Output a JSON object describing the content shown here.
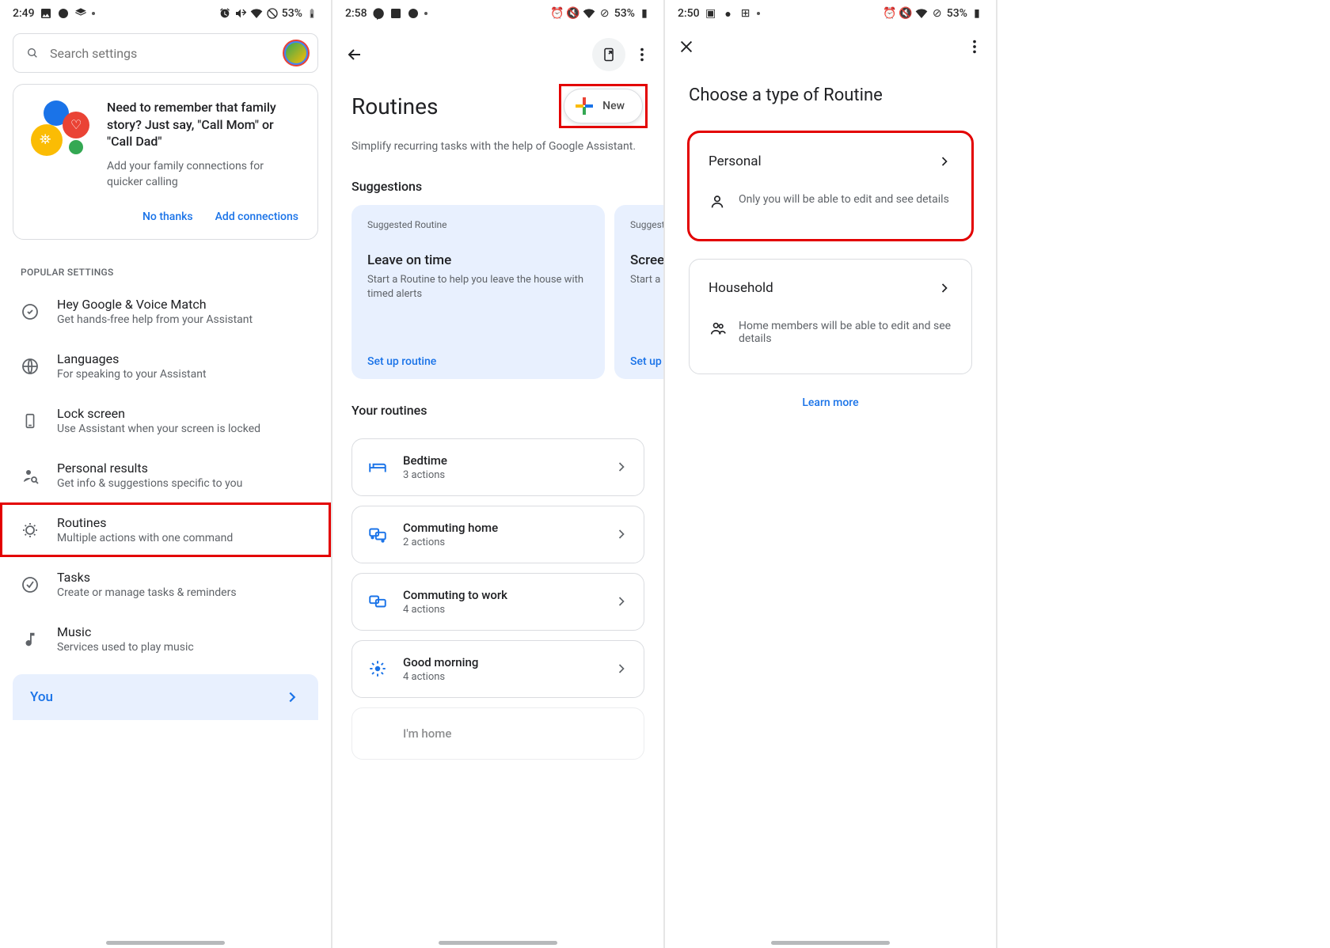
{
  "screen1": {
    "time": "2:49",
    "battery": "53%",
    "search_placeholder": "Search settings",
    "card": {
      "title": "Need to remember that family story? Just say, \"Call Mom\" or \"Call Dad\"",
      "subtitle": "Add your family connections for quicker calling",
      "no_thanks": "No thanks",
      "add_connections": "Add connections"
    },
    "popular_label": "POPULAR SETTINGS",
    "items": [
      {
        "title": "Hey Google & Voice Match",
        "sub": "Get hands-free help from your Assistant"
      },
      {
        "title": "Languages",
        "sub": "For speaking to your Assistant"
      },
      {
        "title": "Lock screen",
        "sub": "Use Assistant when your screen is locked"
      },
      {
        "title": "Personal results",
        "sub": "Get info & suggestions specific to you"
      },
      {
        "title": "Routines",
        "sub": "Multiple actions with one command"
      },
      {
        "title": "Tasks",
        "sub": "Create or manage tasks & reminders"
      },
      {
        "title": "Music",
        "sub": "Services used to play music"
      }
    ],
    "you_label": "You"
  },
  "screen2": {
    "time": "2:58",
    "battery": "53%",
    "title": "Routines",
    "new_label": "New",
    "desc": "Simplify recurring tasks with the help of Google Assistant.",
    "suggestions_label": "Suggestions",
    "suggestion_eyebrow": "Suggested Routine",
    "sugg": [
      {
        "title": "Leave on time",
        "desc": "Start a Routine to help you leave the house with timed alerts",
        "action": "Set up routine"
      },
      {
        "title": "Screen time",
        "desc": "Start a routine with timed alerts",
        "action": "Set up routine"
      }
    ],
    "your_routines_label": "Your routines",
    "routines": [
      {
        "title": "Bedtime",
        "sub": "3 actions"
      },
      {
        "title": "Commuting home",
        "sub": "2 actions"
      },
      {
        "title": "Commuting to work",
        "sub": "4 actions"
      },
      {
        "title": "Good morning",
        "sub": "4 actions"
      }
    ],
    "partial": "I'm home"
  },
  "screen3": {
    "time": "2:50",
    "battery": "53%",
    "title": "Choose a type of Routine",
    "types": [
      {
        "title": "Personal",
        "desc": "Only you will be able to edit and see details"
      },
      {
        "title": "Household",
        "desc": "Home members will be able to edit and see details"
      }
    ],
    "learn_more": "Learn more"
  }
}
